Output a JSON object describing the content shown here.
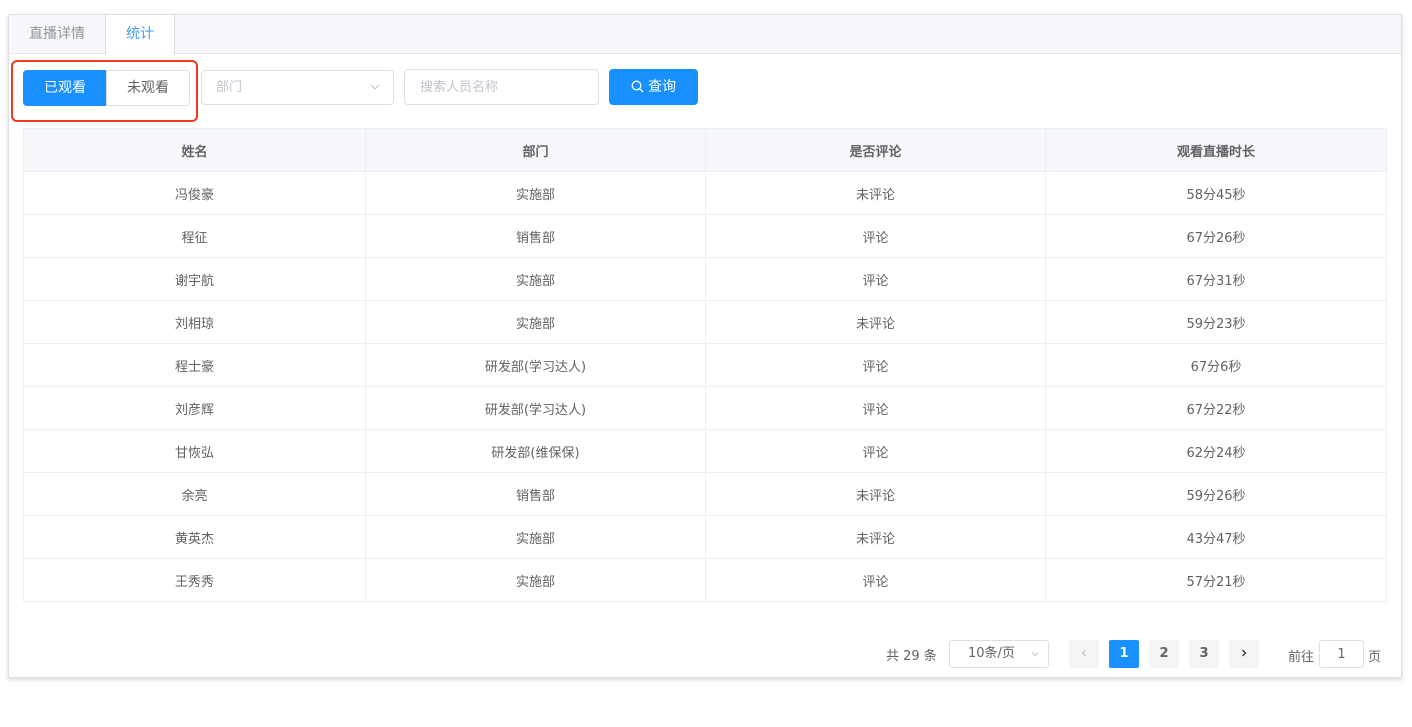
{
  "tabs": [
    {
      "label": "直播详情",
      "active": false
    },
    {
      "label": "统计",
      "active": true
    }
  ],
  "filter": {
    "watched_label": "已观看",
    "unwatched_label": "未观看",
    "department_placeholder": "部门",
    "search_placeholder": "搜索人员名称",
    "query_label": "查询"
  },
  "table": {
    "headers": [
      "姓名",
      "部门",
      "是否评论",
      "观看直播时长"
    ],
    "rows": [
      [
        "冯俊豪",
        "实施部",
        "未评论",
        "58分45秒"
      ],
      [
        "程征",
        "销售部",
        "评论",
        "67分26秒"
      ],
      [
        "谢宇航",
        "实施部",
        "评论",
        "67分31秒"
      ],
      [
        "刘相琼",
        "实施部",
        "未评论",
        "59分23秒"
      ],
      [
        "程士豪",
        "研发部(学习达人)",
        "评论",
        "67分6秒"
      ],
      [
        "刘彦辉",
        "研发部(学习达人)",
        "评论",
        "67分22秒"
      ],
      [
        "甘恢弘",
        "研发部(维保保)",
        "评论",
        "62分24秒"
      ],
      [
        "余亮",
        "销售部",
        "未评论",
        "59分26秒"
      ],
      [
        "黄英杰",
        "实施部",
        "未评论",
        "43分47秒"
      ],
      [
        "王秀秀",
        "实施部",
        "评论",
        "57分21秒"
      ]
    ]
  },
  "pagination": {
    "total_text": "共 29 条",
    "page_size": "10条/页",
    "pages": [
      "1",
      "2",
      "3"
    ],
    "current_page": "1",
    "goto_label": "前往",
    "goto_value": "1",
    "page_suffix": "页"
  },
  "colors": {
    "primary": "#1890ff",
    "highlight": "#f0391f"
  }
}
